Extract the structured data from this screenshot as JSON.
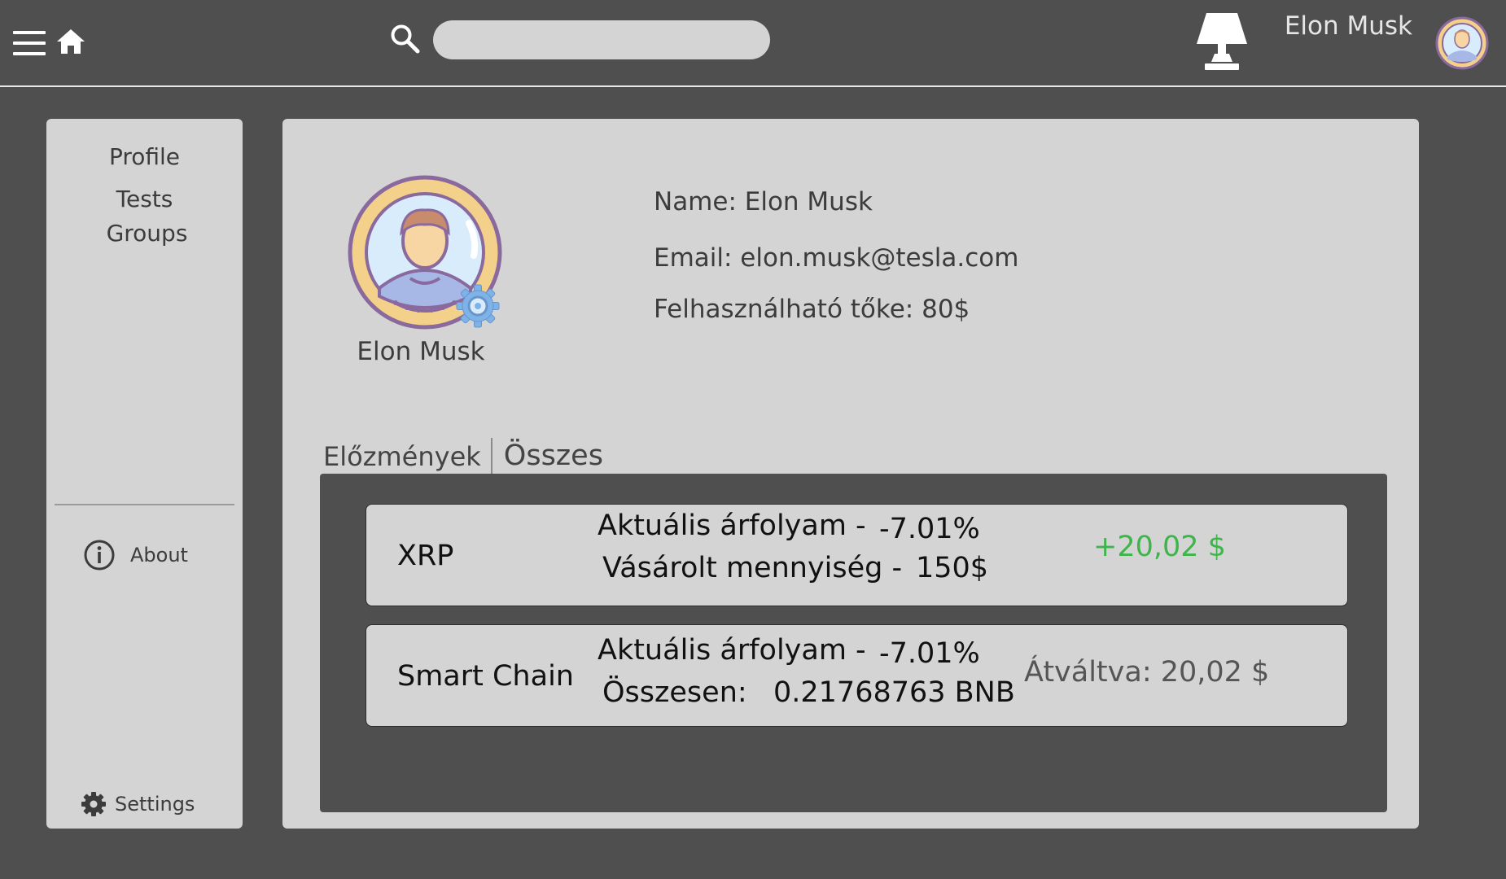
{
  "header": {
    "search_placeholder": "",
    "user_name": "Elon Musk"
  },
  "sidebar": {
    "items": [
      {
        "label": "Profile"
      },
      {
        "label": "Tests"
      },
      {
        "label": "Groups"
      }
    ],
    "about_label": "About",
    "settings_label": "Settings"
  },
  "profile": {
    "display_name": "Elon Musk",
    "name_line": "Name: Elon Musk",
    "email_line": "Email: elon.musk@tesla.com",
    "capital_line": "Felhasználható tőke: 80$"
  },
  "tabs": [
    {
      "label": "Előzmények"
    },
    {
      "label": "Összes",
      "active": true
    }
  ],
  "transactions": [
    {
      "name": "XRP",
      "line1_label": "Aktuális árfolyam -",
      "line1_value": "-7.01%",
      "line2_label": "Vásárolt mennyiség -",
      "line2_value": "150$",
      "result": "+20,02 $",
      "result_color": "#3db54a"
    },
    {
      "name": "Smart Chain",
      "line1_label": "Aktuális árfolyam -",
      "line1_value": "-7.01%",
      "line2_label": "Összesen:",
      "line2_value": "0.21768763 BNB",
      "converted": "Átváltva: 20,02 $"
    }
  ],
  "icons": {
    "menu": "hamburger-menu-icon",
    "home": "home-icon",
    "search": "search-icon",
    "lamp": "lamp-icon",
    "about": "info-icon",
    "settings": "gear-icon"
  },
  "colors": {
    "background": "#4f4f4f",
    "panel": "#d4d4d4",
    "positive": "#3db54a"
  }
}
